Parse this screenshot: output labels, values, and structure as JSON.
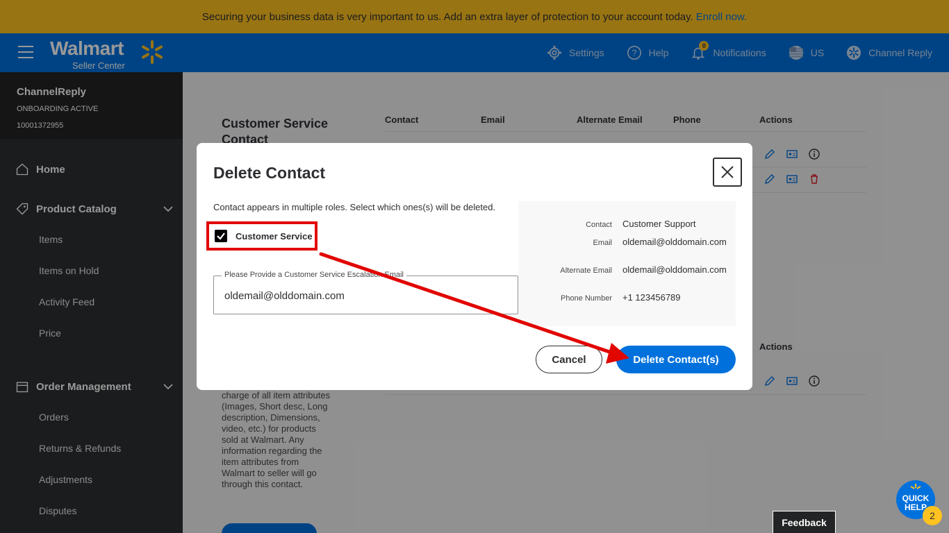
{
  "banner": {
    "text": "Securing your business data is very important to us. Add an extra layer of protection to your account today.",
    "link": "Enroll now."
  },
  "topnav": {
    "logo": "Walmart",
    "logo_sub": "Seller Center",
    "items": {
      "settings": "Settings",
      "help": "Help",
      "notifications": "Notifications",
      "notifications_count": "0",
      "country": "US",
      "account": "Channel Reply"
    }
  },
  "sidebar": {
    "account_name": "ChannelReply",
    "status": "ONBOARDING ACTIVE",
    "account_id": "10001372955",
    "home": "Home",
    "product_catalog": "Product Catalog",
    "catalog_items": [
      "Items",
      "Items on Hold",
      "Activity Feed",
      "Price"
    ],
    "order_management": "Order Management",
    "order_items": [
      "Orders",
      "Returns & Refunds",
      "Adjustments",
      "Disputes"
    ]
  },
  "main": {
    "section_title": "Customer Service Contact",
    "columns": [
      "Contact",
      "Email",
      "Alternate Email",
      "Phone",
      "Actions"
    ],
    "actions_header_2": "Actions",
    "description": "charge of all item attributes (Images, Short desc, Long description, Dimensions, video, etc.) for products sold at Walmart. Any information regarding the item attributes from Walmart to seller will go through this contact."
  },
  "modal": {
    "title": "Delete Contact",
    "description": "Contact appears in multiple roles. Select which ones(s) will be deleted.",
    "checkbox_label": "Customer Service",
    "checkbox_checked": true,
    "field_label": "Please Provide a Customer Service Escalation Email",
    "field_value": "oldemail@olddomain.com",
    "info": {
      "contact_key": "Contact",
      "contact_val": "Customer Support",
      "email_key": "Email",
      "email_val": "oldemail@olddomain.com",
      "alt_email_key": "Alternate Email",
      "alt_email_val": "oldemail@olddomain.com",
      "phone_key": "Phone Number",
      "phone_val": "+1 123456789"
    },
    "cancel": "Cancel",
    "delete": "Delete Contact(s)"
  },
  "feedback": "Feedback",
  "quick_help": {
    "line1": "QUICK",
    "line2": "HELP",
    "badge": "2"
  },
  "colors": {
    "walmart_blue": "#0071dc",
    "spark_yellow": "#ffc220",
    "highlight_red": "#e10600",
    "sidebar_dark": "#2e2f32"
  }
}
